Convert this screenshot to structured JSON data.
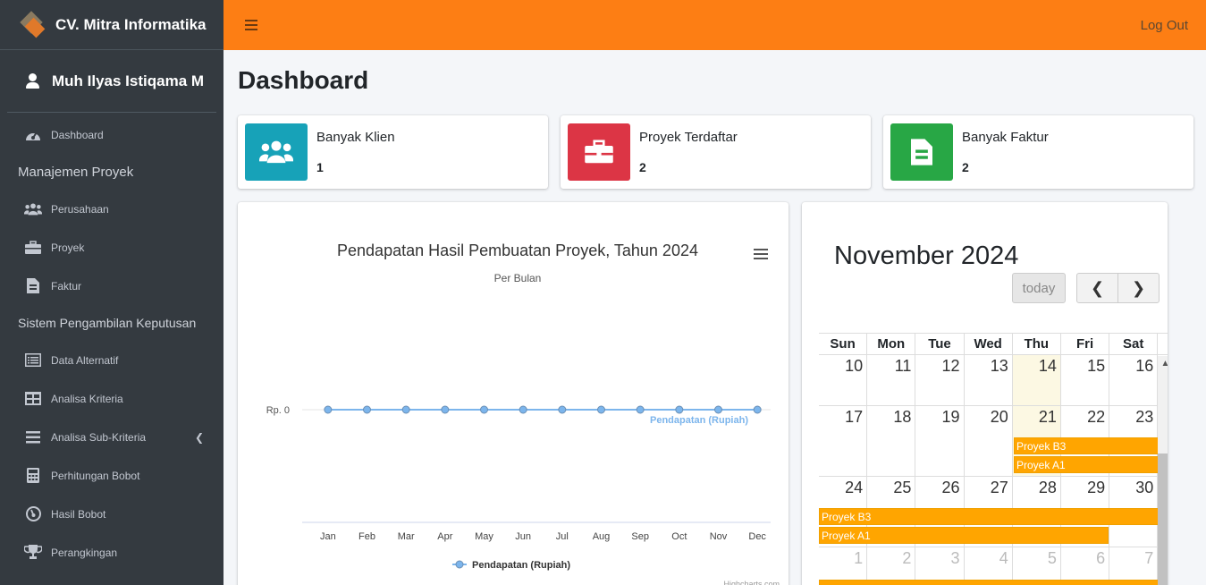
{
  "brand": {
    "name": "CV. Mitra Informatika"
  },
  "user": {
    "name": "Muh Ilyas Istiqama M"
  },
  "sidebar": {
    "items": [
      {
        "label": "Dashboard",
        "icon": "tachometer-icon"
      },
      {
        "label": "Manajemen Proyek",
        "header": true
      },
      {
        "label": "Perusahaan",
        "icon": "users-icon"
      },
      {
        "label": "Proyek",
        "icon": "briefcase-icon"
      },
      {
        "label": "Faktur",
        "icon": "file-invoice-icon"
      },
      {
        "label": "Sistem Pengambilan Keputusan",
        "header": true
      },
      {
        "label": "Data Alternatif",
        "icon": "list-icon"
      },
      {
        "label": "Analisa Kriteria",
        "icon": "table-icon"
      },
      {
        "label": "Analisa Sub-Kriteria",
        "icon": "bars-icon"
      },
      {
        "label": "Perhitungan Bobot",
        "icon": "calculator-icon"
      },
      {
        "label": "Hasil Bobot",
        "icon": "gauge-icon"
      },
      {
        "label": "Perangkingan",
        "icon": "trophy-icon"
      }
    ]
  },
  "topbar": {
    "logout_label": "Log Out"
  },
  "page": {
    "title": "Dashboard"
  },
  "info_boxes": [
    {
      "label": "Banyak Klien",
      "value": "1",
      "color": "#17a2b8",
      "icon": "users-icon"
    },
    {
      "label": "Proyek Terdaftar",
      "value": "2",
      "color": "#dc3545",
      "icon": "briefcase-icon"
    },
    {
      "label": "Banyak Faktur",
      "value": "2",
      "color": "#28a745",
      "icon": "file-invoice-icon"
    }
  ],
  "chart_data": {
    "type": "line",
    "title": "Pendapatan Hasil Pembuatan Proyek, Tahun 2024",
    "subtitle": "Per Bulan",
    "categories": [
      "Jan",
      "Feb",
      "Mar",
      "Apr",
      "May",
      "Jun",
      "Jul",
      "Aug",
      "Sep",
      "Oct",
      "Nov",
      "Dec"
    ],
    "series": [
      {
        "name": "Pendapatan (Rupiah)",
        "values": [
          0,
          0,
          0,
          0,
          0,
          0,
          0,
          0,
          0,
          0,
          0,
          0
        ],
        "color": "#7cb5ec"
      }
    ],
    "y_tick_label": "Rp. 0",
    "legend": "bottom",
    "credits": "Highcharts.com"
  },
  "calendar": {
    "title": "November 2024",
    "today_label": "today",
    "weekdays": [
      "Sun",
      "Mon",
      "Tue",
      "Wed",
      "Thu",
      "Fri",
      "Sat"
    ],
    "weeks": [
      [
        "10",
        "11",
        "12",
        "13",
        "14",
        "15",
        "16"
      ],
      [
        "17",
        "18",
        "19",
        "20",
        "21",
        "22",
        "23"
      ],
      [
        "24",
        "25",
        "26",
        "27",
        "28",
        "29",
        "30"
      ],
      [
        "1",
        "2",
        "3",
        "4",
        "5",
        "6",
        "7"
      ]
    ],
    "events": [
      {
        "title": "Proyek B3",
        "color": "#ffa500"
      },
      {
        "title": "Proyek A1",
        "color": "#ffa500"
      }
    ]
  }
}
